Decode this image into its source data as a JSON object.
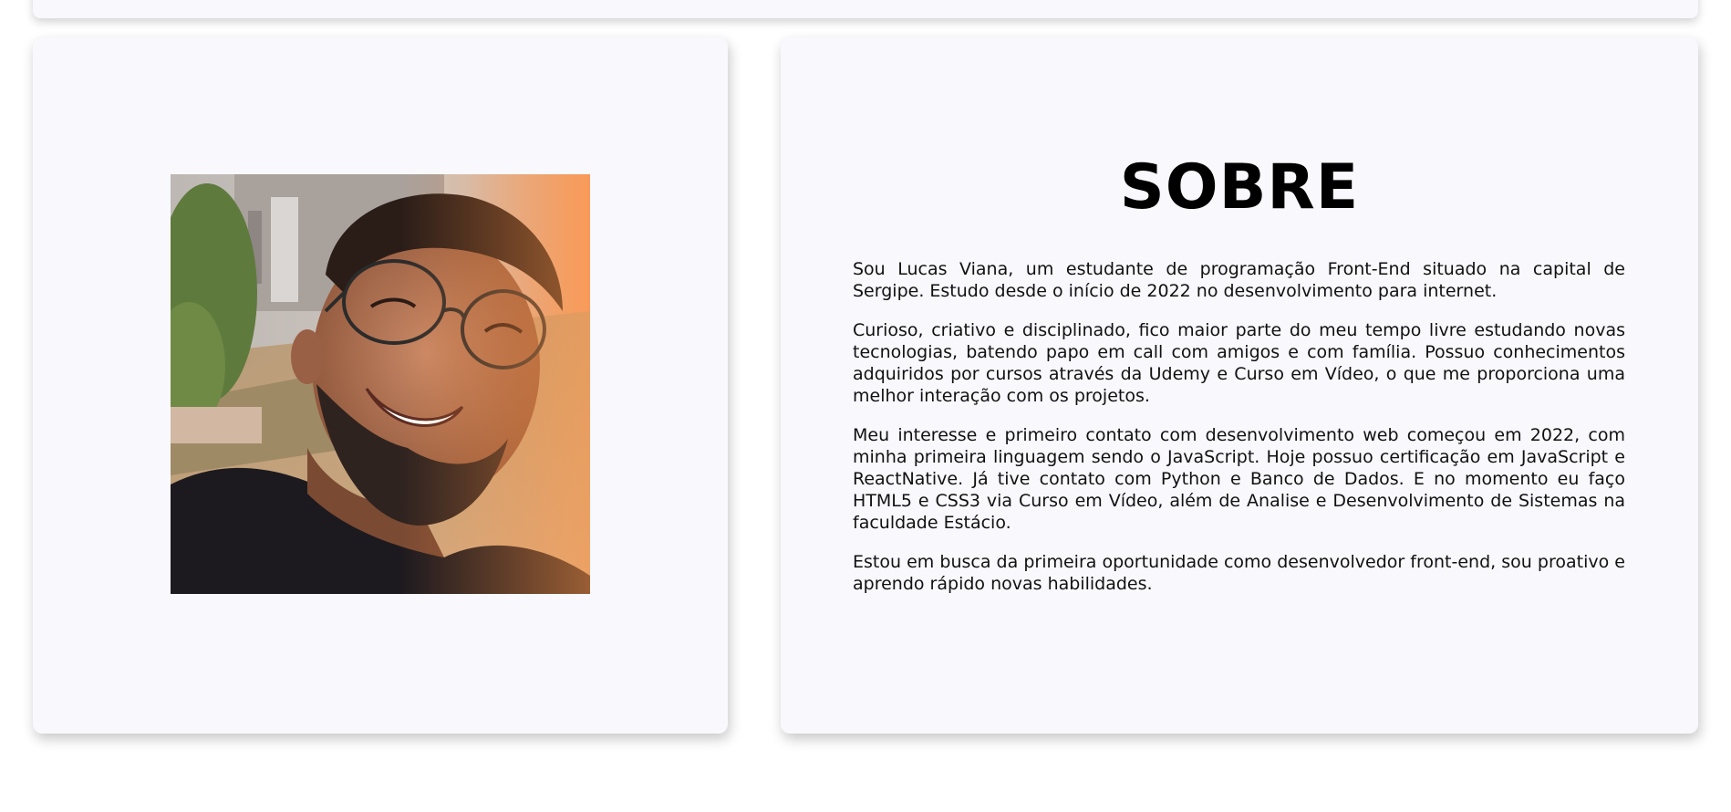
{
  "about": {
    "title": "SOBRE",
    "paragraphs": [
      "Sou Lucas Viana, um estudante de programação Front-End situado na capital de Sergipe. Estudo desde o início de 2022 no desenvolvimento para internet.",
      "Curioso, criativo e disciplinado, fico maior parte do meu tempo livre estudando novas tecnologias, batendo papo em call com amigos e com família. Possuo conhecimentos adquiridos por cursos através da Udemy e Curso em Vídeo, o que me proporciona uma melhor interação com os projetos.",
      "Meu interesse e primeiro contato com desenvolvimento web começou em 2022, com minha primeira linguagem sendo o JavaScript. Hoje possuo certificação em JavaScript e ReactNative. Já tive contato com Python e Banco de Dados. E no momento eu faço HTML5 e CSS3 via Curso em Vídeo, além de Analise e Desenvolvimento de Sistemas na faculdade Estácio.",
      "Estou em busca da primeira oportunidade como desenvolvedor front-end, sou proativo e aprendo rápido novas habilidades."
    ]
  },
  "colors": {
    "card_background": "#f8f8fd",
    "page_background": "#ffffff",
    "text": "#111111"
  }
}
